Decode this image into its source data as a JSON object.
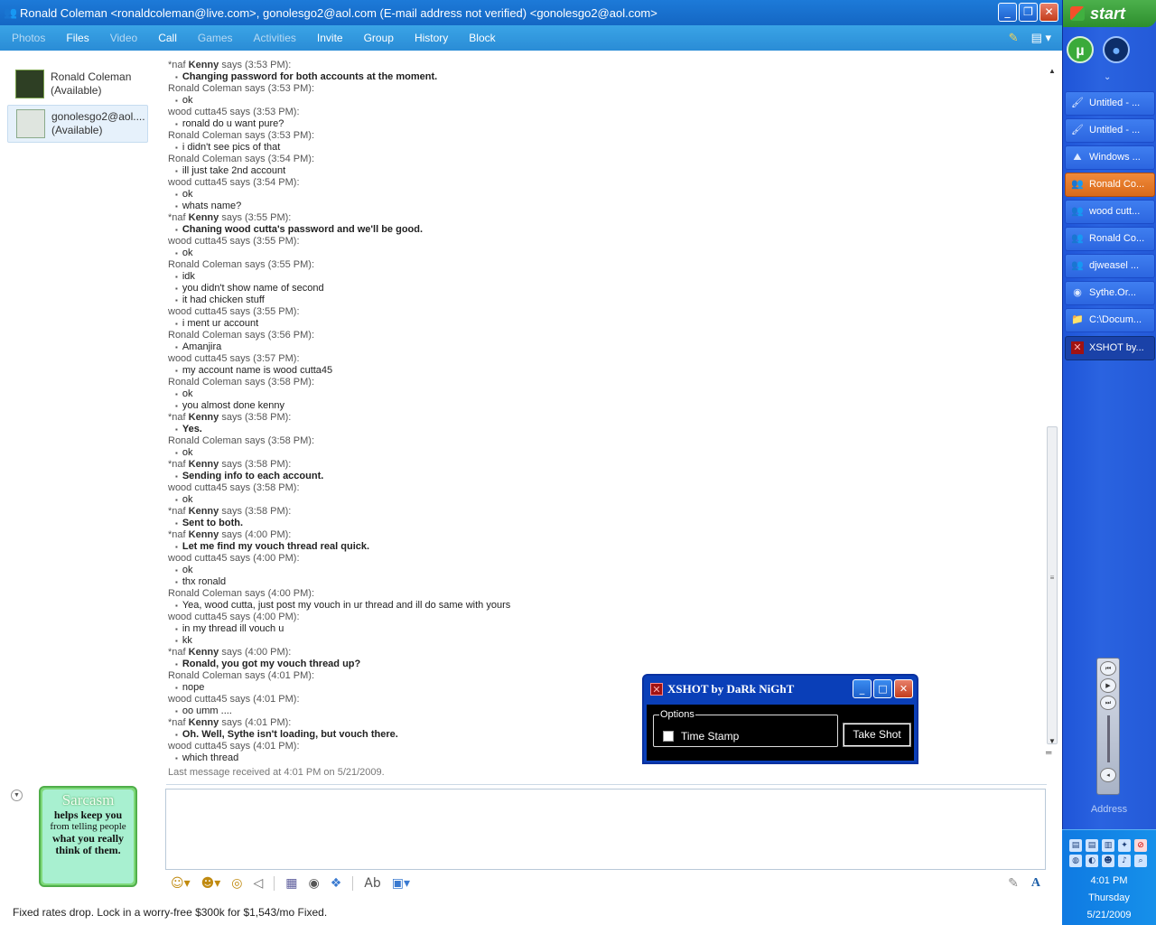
{
  "window": {
    "title": "Ronald Coleman <ronaldcoleman@live.com>, gonolesgo2@aol.com (E-mail address not verified) <gonolesgo2@aol.com>",
    "controls": {
      "minimize": "_",
      "restore": "❐",
      "close": "✕"
    }
  },
  "menu": [
    {
      "label": "Photos",
      "enabled": false
    },
    {
      "label": "Files",
      "enabled": true
    },
    {
      "label": "Video",
      "enabled": false
    },
    {
      "label": "Call",
      "enabled": true
    },
    {
      "label": "Games",
      "enabled": false
    },
    {
      "label": "Activities",
      "enabled": false
    },
    {
      "label": "Invite",
      "enabled": true
    },
    {
      "label": "Group",
      "enabled": true
    },
    {
      "label": "History",
      "enabled": true
    },
    {
      "label": "Block",
      "enabled": true
    }
  ],
  "contacts": [
    {
      "name": "Ronald Coleman",
      "status": "(Available)",
      "avatar": "photo-avatar"
    },
    {
      "name": "gonolesgo2@aol....",
      "status": "(Available)",
      "avatar": "default-avatar"
    }
  ],
  "conversation": [
    {
      "prefix": "*naf",
      "sender": "Kenny",
      "time": "says (3:53 PM):",
      "bold": true,
      "messages": [
        "Changing password for both accounts at the moment."
      ]
    },
    {
      "sender": "Ronald Coleman",
      "time": "says (3:53 PM):",
      "messages": [
        "ok"
      ]
    },
    {
      "sender": "wood cutta45",
      "time": "says (3:53 PM):",
      "messages": [
        "ronald do u want pure?"
      ]
    },
    {
      "sender": "Ronald Coleman",
      "time": "says (3:53 PM):",
      "messages": [
        "i didn't see pics of that"
      ]
    },
    {
      "sender": "Ronald Coleman",
      "time": "says (3:54 PM):",
      "messages": [
        "ill just take 2nd account"
      ]
    },
    {
      "sender": "wood cutta45",
      "time": "says (3:54 PM):",
      "messages": [
        "ok",
        "whats name?"
      ]
    },
    {
      "prefix": "*naf",
      "sender": "Kenny",
      "time": "says (3:55 PM):",
      "bold": true,
      "messages": [
        "Chaning wood cutta's password and we'll be good."
      ]
    },
    {
      "sender": "wood cutta45",
      "time": "says (3:55 PM):",
      "messages": [
        "ok"
      ]
    },
    {
      "sender": "Ronald Coleman",
      "time": "says (3:55 PM):",
      "messages": [
        "idk",
        "you didn't show name of second",
        "it had chicken stuff"
      ]
    },
    {
      "sender": "wood cutta45",
      "time": "says (3:55 PM):",
      "messages": [
        "i ment ur account"
      ]
    },
    {
      "sender": "Ronald Coleman",
      "time": "says (3:56 PM):",
      "messages": [
        "Amanjira"
      ]
    },
    {
      "sender": "wood cutta45",
      "time": "says (3:57 PM):",
      "messages": [
        "my account name is wood cutta45"
      ]
    },
    {
      "sender": "Ronald Coleman",
      "time": "says (3:58 PM):",
      "messages": [
        "ok",
        "you almost done kenny"
      ]
    },
    {
      "prefix": "*naf",
      "sender": "Kenny",
      "time": "says (3:58 PM):",
      "bold": true,
      "messages": [
        "Yes."
      ]
    },
    {
      "sender": "Ronald Coleman",
      "time": "says (3:58 PM):",
      "messages": [
        "ok"
      ]
    },
    {
      "prefix": "*naf",
      "sender": "Kenny",
      "time": "says (3:58 PM):",
      "bold": true,
      "messages": [
        "Sending info to each account."
      ]
    },
    {
      "sender": "wood cutta45",
      "time": "says (3:58 PM):",
      "messages": [
        "ok"
      ]
    },
    {
      "prefix": "*naf",
      "sender": "Kenny",
      "time": "says (3:58 PM):",
      "bold": true,
      "messages": [
        "Sent to both."
      ]
    },
    {
      "prefix": "*naf",
      "sender": "Kenny",
      "time": "says (4:00 PM):",
      "bold": true,
      "messages": [
        "Let me find my vouch thread real quick."
      ]
    },
    {
      "sender": "wood cutta45",
      "time": "says (4:00 PM):",
      "messages": [
        "ok",
        "thx ronald"
      ]
    },
    {
      "sender": "Ronald Coleman",
      "time": "says (4:00 PM):",
      "messages": [
        "Yea, wood cutta, just post my vouch in ur thread and ill do same with yours"
      ]
    },
    {
      "sender": "wood cutta45",
      "time": "says (4:00 PM):",
      "messages": [
        "in my thread ill vouch u",
        "kk"
      ]
    },
    {
      "prefix": "*naf",
      "sender": "Kenny",
      "time": "says (4:00 PM):",
      "bold": true,
      "messages": [
        "Ronald, you got my vouch thread up?"
      ]
    },
    {
      "sender": "Ronald Coleman",
      "time": "says (4:01 PM):",
      "messages": [
        "nope"
      ]
    },
    {
      "sender": "wood cutta45",
      "time": "says (4:01 PM):",
      "messages": [
        "oo umm ...."
      ]
    },
    {
      "prefix": "*naf",
      "sender": "Kenny",
      "time": "says (4:01 PM):",
      "bold": true,
      "messages": [
        "Oh. Well, Sythe isn't loading, but vouch there."
      ]
    },
    {
      "sender": "wood cutta45",
      "time": "says (4:01 PM):",
      "messages": [
        "which thread"
      ]
    }
  ],
  "last_message": "Last message received at 4:01 PM on 5/21/2009.",
  "display_picture": {
    "line1": "Sarcasm",
    "line2": "helps keep you",
    "line3": "from telling people",
    "line4": "what you really",
    "line5": "think of them."
  },
  "format_toolbar": [
    "emoticon-icon",
    "wink-icon",
    "nudge-icon",
    "voice-clip-icon",
    "background-icon",
    "games-icon",
    "gift-icon",
    "spell-check-icon",
    "send-files-icon",
    "handwriting-icon",
    "font-icon"
  ],
  "ad": "Fixed rates drop. Lock in a worry-free $300k for $1,543/mo Fixed.",
  "xshot": {
    "title": "XSHOT by DaRk NiGhT",
    "options_legend": "Options",
    "time_stamp_label": "Time Stamp",
    "time_stamp_checked": false,
    "take_shot_label": "Take Shot"
  },
  "taskbar": {
    "start_label": "start",
    "tasks": [
      {
        "label": "Untitled - ...",
        "icon": "paint-icon",
        "state": "normal"
      },
      {
        "label": "Untitled - ...",
        "icon": "paint-icon",
        "state": "normal"
      },
      {
        "label": "Windows ...",
        "icon": "windows-live-icon",
        "state": "normal"
      },
      {
        "label": "Ronald Co...",
        "icon": "messenger-icon",
        "state": "active"
      },
      {
        "label": "wood cutt...",
        "icon": "messenger-icon",
        "state": "normal"
      },
      {
        "label": "Ronald Co...",
        "icon": "messenger-icon",
        "state": "normal"
      },
      {
        "label": "djweasel ...",
        "icon": "messenger-icon",
        "state": "normal"
      },
      {
        "label": "Sythe.Or...",
        "icon": "firefox-icon",
        "state": "normal"
      },
      {
        "label": "C:\\Docum...",
        "icon": "folder-icon",
        "state": "normal"
      },
      {
        "label": "XSHOT by...",
        "icon": "xshot-icon",
        "state": "pressed"
      }
    ],
    "address_label": "Address",
    "clock": {
      "time": "4:01 PM",
      "day": "Thursday",
      "date": "5/21/2009"
    }
  },
  "colors": {
    "title_blue": "#1467c4",
    "menu_blue": "#2a8cd6",
    "taskbar_blue": "#245ad8",
    "active_task": "#d96a1a",
    "start_green": "#2d8f2d"
  }
}
